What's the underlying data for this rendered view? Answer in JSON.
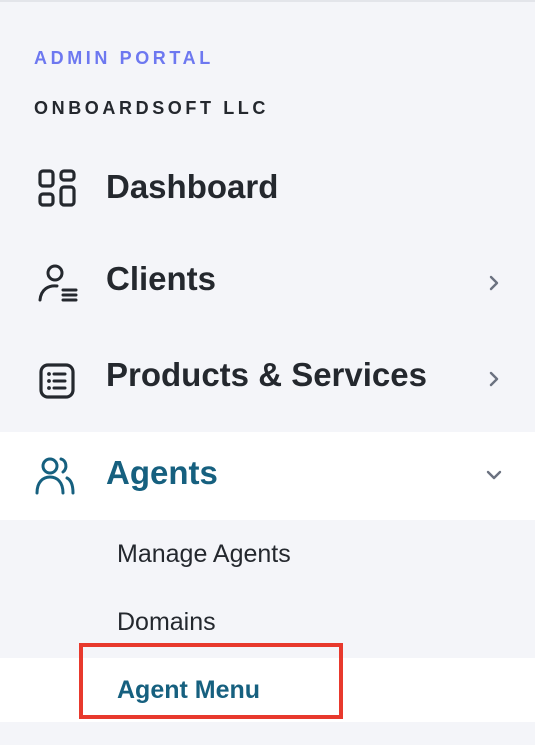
{
  "brand": {
    "portal_label": "ADMIN PORTAL",
    "company_name": "ONBOARDSOFT LLC"
  },
  "nav": {
    "items": [
      {
        "label": "Dashboard",
        "icon": "dashboard-grid-icon"
      },
      {
        "label": "Clients",
        "icon": "user-list-icon"
      },
      {
        "label": "Products & Services",
        "icon": "list-document-icon"
      },
      {
        "label": "Agents",
        "icon": "users-group-icon",
        "active": true
      }
    ]
  },
  "agents_submenu": {
    "items": [
      {
        "label": "Manage Agents"
      },
      {
        "label": "Domains"
      },
      {
        "label": "Agent Menu",
        "active": true
      }
    ]
  },
  "colors": {
    "accent": "#16607f",
    "brand_blue": "#6d78f0",
    "highlight_red": "#e8392d",
    "sidebar_bg": "#f4f5f9"
  }
}
